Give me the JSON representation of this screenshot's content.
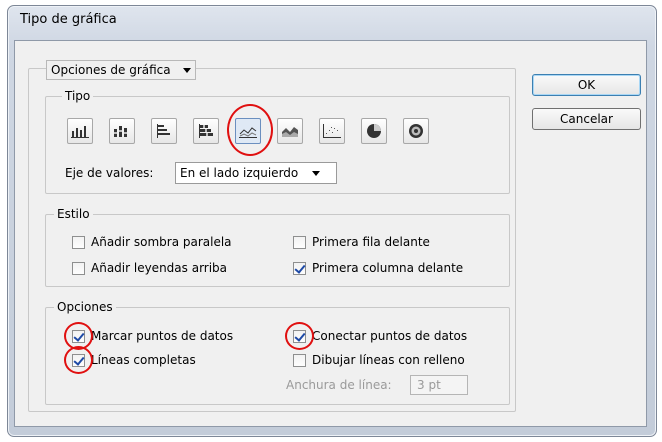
{
  "window": {
    "title": "Tipo de gráfica"
  },
  "section_dropdown": {
    "value": "Opciones de gráfica"
  },
  "buttons": {
    "ok": "OK",
    "cancel": "Cancelar"
  },
  "tipo": {
    "legend": "Tipo",
    "chart_types": [
      {
        "icon": "column-chart-icon"
      },
      {
        "icon": "stacked-column-chart-icon"
      },
      {
        "icon": "bar-chart-icon"
      },
      {
        "icon": "stacked-bar-chart-icon"
      },
      {
        "icon": "line-chart-icon",
        "selected": true
      },
      {
        "icon": "area-chart-icon"
      },
      {
        "icon": "scatter-chart-icon"
      },
      {
        "icon": "pie-chart-icon"
      },
      {
        "icon": "radar-chart-icon"
      }
    ],
    "value_axis_label": "Eje de valores:",
    "value_axis_value": "En el lado izquierdo"
  },
  "estilo": {
    "legend": "Estilo",
    "add_shadow": "Añadir sombra paralela",
    "add_legends_top": "Añadir leyendas arriba",
    "first_row_front": "Primera fila delante",
    "first_column_front": "Primera columna delante"
  },
  "opciones": {
    "legend": "Opciones",
    "mark_points": "Marcar puntos de datos",
    "connect_points": "Conectar puntos de datos",
    "full_lines": "Líneas completas",
    "draw_filled_lines": "Dibujar líneas con relleno",
    "line_width_label": "Anchura de línea:",
    "line_width_value": "3 pt"
  },
  "colors": {
    "highlight_ring": "#e01010",
    "check": "#1e4aa6"
  }
}
